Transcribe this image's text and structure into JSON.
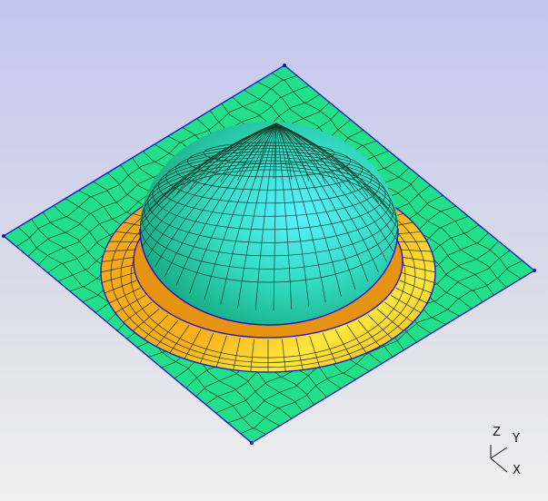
{
  "viewport": {
    "background_top": "#c3c6f0",
    "background_bottom": "#f0f0f0"
  },
  "model": {
    "plate_color": "#22e08a",
    "flange_color": "#f7aa18",
    "flange_highlight": "#ffe23a",
    "dome_color_light": "#45e8e8",
    "dome_color_dark": "#12a87a",
    "mesh_line_color": "#0d2414",
    "edge_color": "#1010cc"
  },
  "triad": {
    "z_label": "Z",
    "y_label": "Y",
    "x_label": "X",
    "color": "#111111"
  }
}
